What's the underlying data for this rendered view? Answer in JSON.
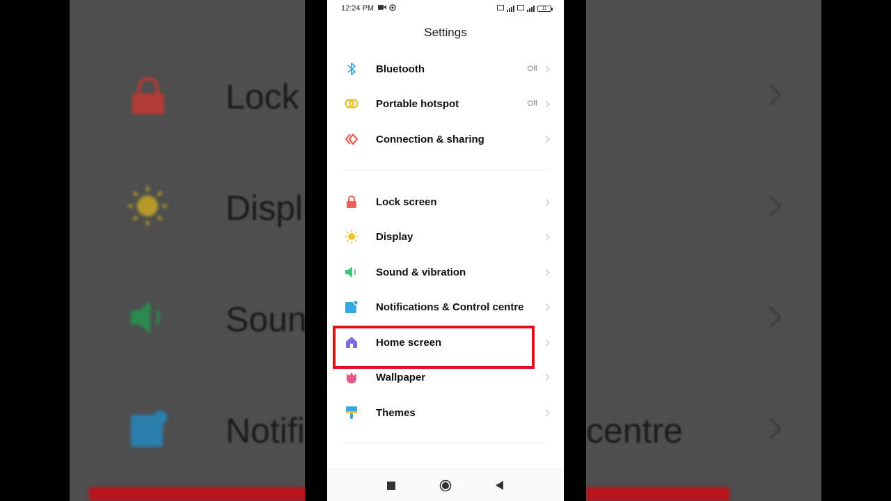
{
  "status_bar": {
    "time": "12:24 PM",
    "battery": "11"
  },
  "header": {
    "title": "Settings"
  },
  "groups": [
    {
      "items": [
        {
          "label": "Bluetooth",
          "value": "Off",
          "icon": "bluetooth-icon",
          "color": "#3aa6e0"
        },
        {
          "label": "Portable hotspot",
          "value": "Off",
          "icon": "hotspot-icon",
          "color": "#e8c22a"
        },
        {
          "label": "Connection & sharing",
          "value": "",
          "icon": "connection-icon",
          "color": "#e46a5f"
        }
      ]
    },
    {
      "items": [
        {
          "label": "Lock screen",
          "value": "",
          "icon": "lock-icon",
          "color": "#e8615a"
        },
        {
          "label": "Display",
          "value": "",
          "icon": "sun-icon",
          "color": "#f2c12e"
        },
        {
          "label": "Sound & vibration",
          "value": "",
          "icon": "speaker-icon",
          "color": "#3cc97a"
        },
        {
          "label": "Notifications & Control centre",
          "value": "",
          "icon": "notification-icon",
          "color": "#39a9e3"
        },
        {
          "label": "Home screen",
          "value": "",
          "icon": "home-icon",
          "color": "#7b6fe0"
        },
        {
          "label": "Wallpaper",
          "value": "",
          "icon": "wallpaper-icon",
          "color": "#e55a8a"
        },
        {
          "label": "Themes",
          "value": "",
          "icon": "themes-icon",
          "color": "#3aa6e0"
        }
      ]
    }
  ],
  "background": {
    "labels": [
      "Lock",
      "Displ",
      "Soun",
      "Notifi",
      "centre"
    ]
  },
  "highlight_color": "#e0101b"
}
